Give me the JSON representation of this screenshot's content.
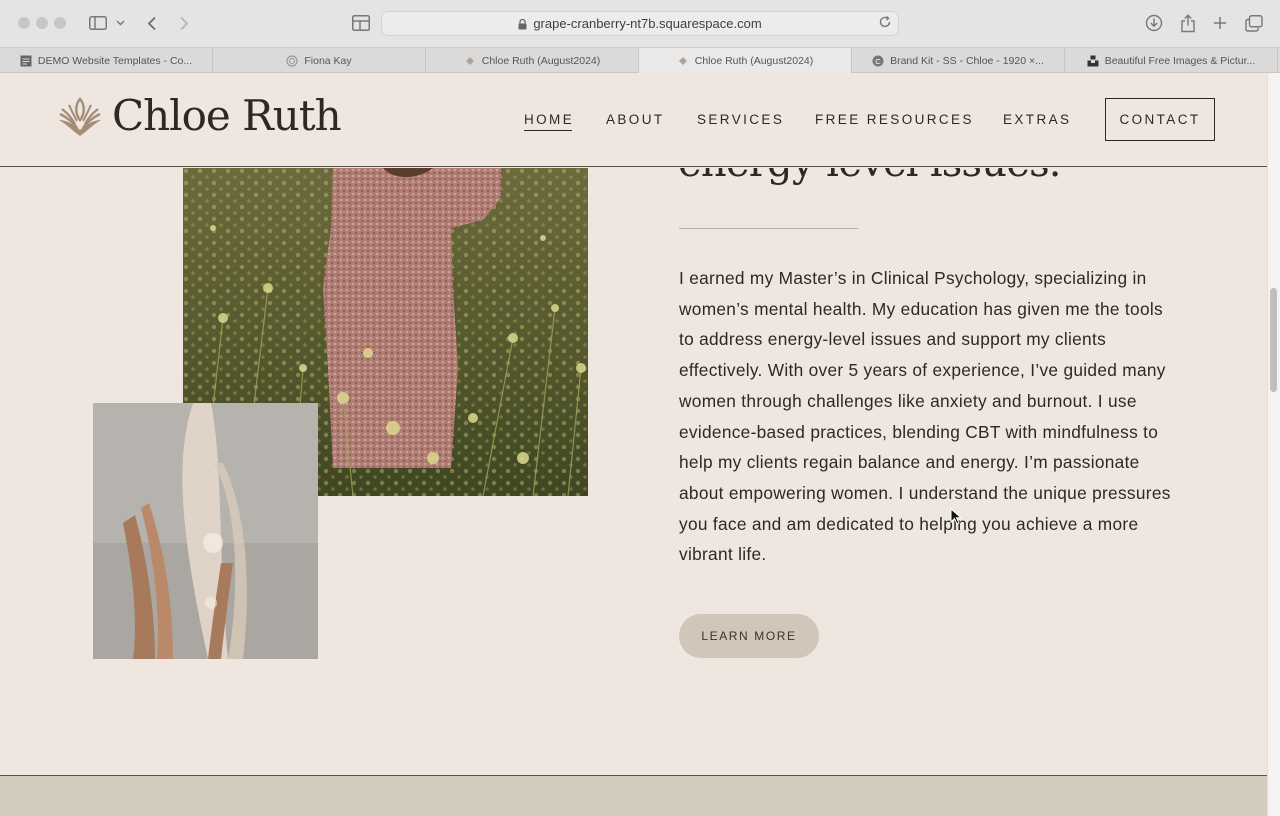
{
  "browser": {
    "url": "grape-cranberry-nt7b.squarespace.com",
    "tabs": [
      {
        "label": "DEMO Website Templates - Co...",
        "icon": "document-icon",
        "active": false
      },
      {
        "label": "Fiona Kay",
        "icon": "circle-icon",
        "active": false
      },
      {
        "label": "Chloe Ruth (August2024)",
        "icon": "diamond-icon",
        "active": false
      },
      {
        "label": "Chloe Ruth (August2024)",
        "icon": "diamond-icon",
        "active": true
      },
      {
        "label": "Brand Kit - SS - Chloe - 1920 ×...",
        "icon": "canva-icon",
        "active": false
      },
      {
        "label": "Beautiful Free Images & Pictur...",
        "icon": "unsplash-icon",
        "active": false
      }
    ]
  },
  "site": {
    "brand": "Chloe Ruth",
    "nav": [
      {
        "label": "HOME",
        "active": true
      },
      {
        "label": "ABOUT",
        "active": false
      },
      {
        "label": "SERVICES",
        "active": false
      },
      {
        "label": "FREE RESOURCES",
        "active": false
      },
      {
        "label": "EXTRAS",
        "active": false
      }
    ],
    "contact_label": "CONTACT"
  },
  "section": {
    "heading_partial": "energy-level issues.",
    "body": "I earned my Master’s in Clinical Psychology, specializing in women’s mental health. My education has given me the tools to address energy-level issues and support my clients effectively. With over 5 years of experience, I’ve guided many women through challenges like anxiety and burnout. I use evidence-based practices, blending CBT with mindfulness to help my clients regain balance and energy. I’m passionate about empowering women. I understand the unique pressures you face and am dedicated to helping you achieve a more vibrant life.",
    "button_label": "LEARN MORE"
  },
  "colors": {
    "page_bg": "#efe7df",
    "text": "#2e2823",
    "button_bg": "#d0c6b9",
    "logo": "#a48d77",
    "footer_band": "#d4cbbf"
  }
}
